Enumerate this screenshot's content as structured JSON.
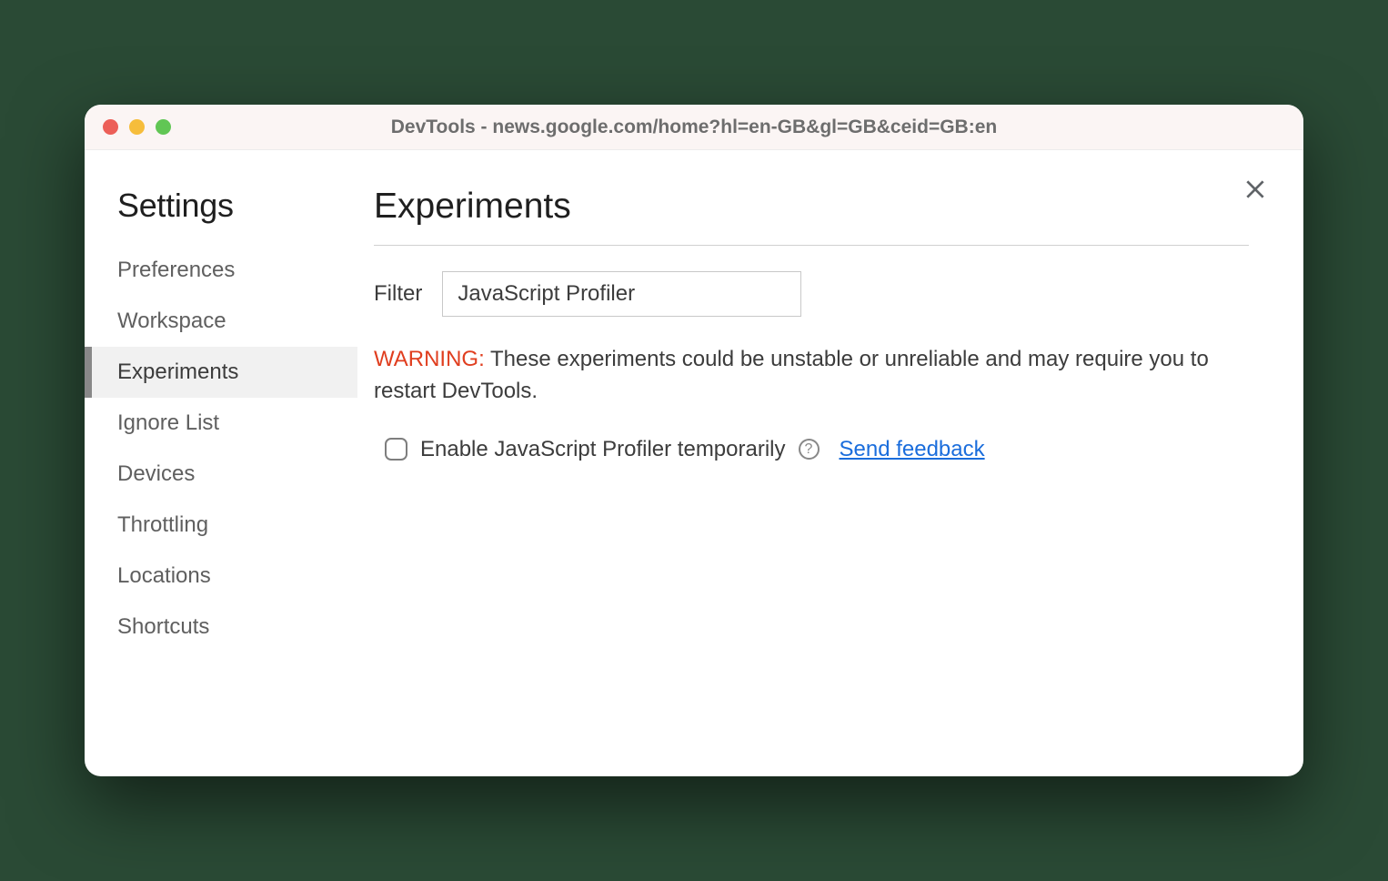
{
  "window": {
    "title": "DevTools - news.google.com/home?hl=en-GB&gl=GB&ceid=GB:en"
  },
  "sidebar": {
    "title": "Settings",
    "items": [
      {
        "label": "Preferences",
        "active": false
      },
      {
        "label": "Workspace",
        "active": false
      },
      {
        "label": "Experiments",
        "active": true
      },
      {
        "label": "Ignore List",
        "active": false
      },
      {
        "label": "Devices",
        "active": false
      },
      {
        "label": "Throttling",
        "active": false
      },
      {
        "label": "Locations",
        "active": false
      },
      {
        "label": "Shortcuts",
        "active": false
      }
    ]
  },
  "main": {
    "title": "Experiments",
    "filter_label": "Filter",
    "filter_value": "JavaScript Profiler",
    "warning_label": "WARNING:",
    "warning_text": " These experiments could be unstable or unreliable and may require you to restart DevTools.",
    "experiment": {
      "checked": false,
      "label": "Enable JavaScript Profiler temporarily",
      "feedback_label": "Send feedback"
    }
  }
}
